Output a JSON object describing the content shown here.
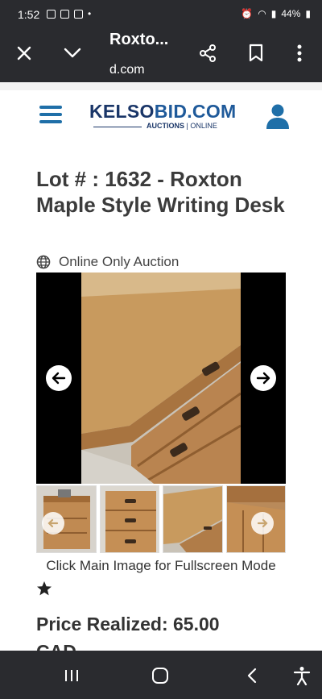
{
  "status_bar": {
    "time": "1:52",
    "battery": "44%"
  },
  "browser": {
    "tab_title": "Roxto...",
    "url_dim": "",
    "url": "d.com"
  },
  "site": {
    "logo_main_a": "KELSO",
    "logo_main_b": "BID.COM",
    "logo_sub_a": "AUCTIONS",
    "logo_sub_b": " | ONLINE"
  },
  "lot": {
    "title": "Lot # : 1632 - Roxton Maple Style Writing Desk",
    "auction_type": "Online Only Auction",
    "fullscreen_note": "Click Main Image for Fullscreen Mode",
    "price": "Price Realized: 65.00",
    "price_continued": "CAD"
  },
  "colors": {
    "brand": "#1a3668",
    "accent": "#1f6fa8",
    "system_bar": "#2a2b2f"
  }
}
